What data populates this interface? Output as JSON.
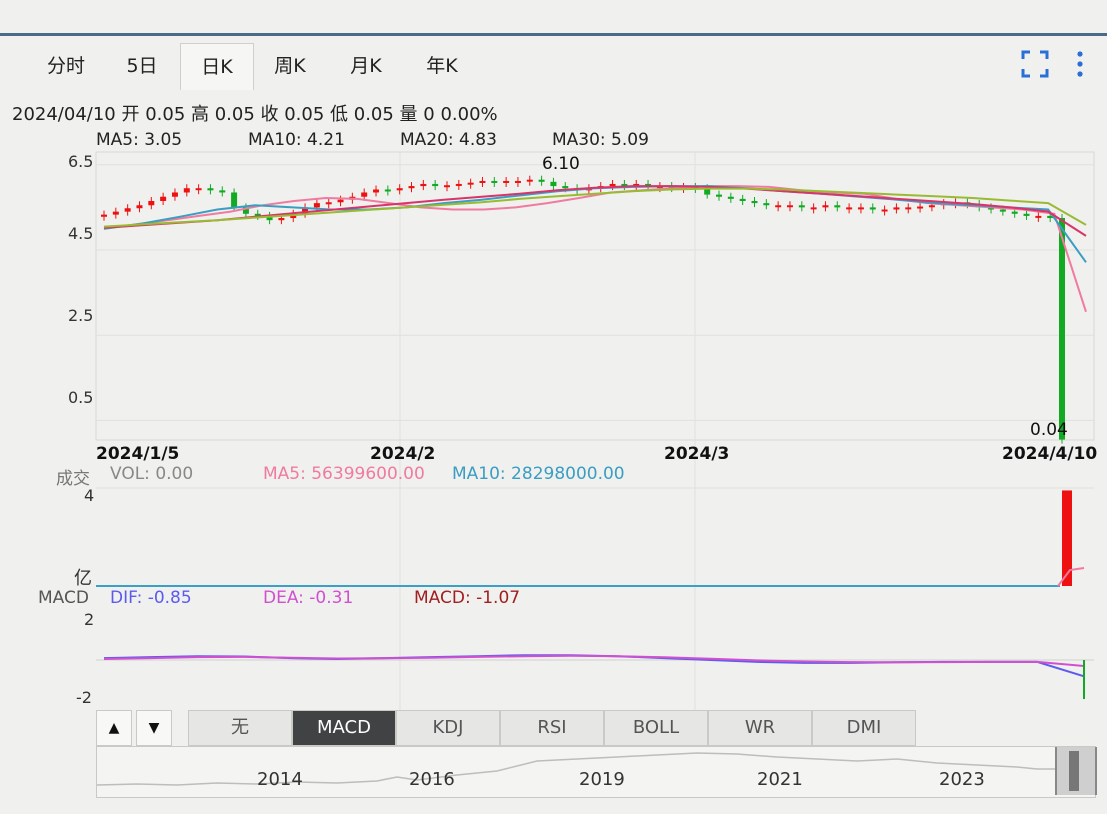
{
  "tabs": [
    {
      "label": "分时"
    },
    {
      "label": "5日"
    },
    {
      "label": "日K"
    },
    {
      "label": "周K"
    },
    {
      "label": "月K"
    },
    {
      "label": "年K"
    }
  ],
  "active_tab": "日K",
  "quote": {
    "text": "2024/04/10 开 0.05 高 0.05 收 0.05 低 0.05 量 0 0.00%"
  },
  "ma_labels": [
    {
      "text": "MA5: 3.05",
      "color": "#f07aa0"
    },
    {
      "text": "MA10: 4.21",
      "color": "#3a9ec2"
    },
    {
      "text": "MA20: 4.83",
      "color": "#d8346a"
    },
    {
      "text": "MA30: 5.09",
      "color": "#7a9a2a"
    }
  ],
  "volume_labels": {
    "title": "成交",
    "vol": "VOL: 0.00",
    "ma5": "MA5: 56399600.00",
    "ma10": "MA10: 28298000.00",
    "unit": "亿"
  },
  "macd_labels": {
    "title": "MACD",
    "dif": "DIF: -0.85",
    "dea": "DEA: -0.31",
    "macd": "MACD: -1.07"
  },
  "indicator_tabs": [
    "无",
    "MACD",
    "KDJ",
    "RSI",
    "BOLL",
    "WR",
    "DMI"
  ],
  "active_indicator": "MACD",
  "navigator_years": [
    "2014",
    "2016",
    "2019",
    "2021",
    "2023"
  ],
  "chart_data": [
    {
      "type": "candlestick",
      "x_labels": [
        "2024/1/5",
        "2024/2",
        "2024/3",
        "2024/4/10"
      ],
      "y_ticks": [
        "6.5",
        "4.5",
        "2.5",
        "0.5"
      ],
      "ylim": [
        0.04,
        6.5
      ],
      "annotations": {
        "high": "6.10",
        "low": "0.04"
      },
      "colors": {
        "up": "#ee1111",
        "down": "#11aa22",
        "ma5": "#f07aa0",
        "ma10": "#3a9ec2",
        "ma20": "#d8346a",
        "ma30": "#99bb33"
      },
      "closes": [
        5.33,
        5.4,
        5.48,
        5.55,
        5.65,
        5.75,
        5.85,
        5.95,
        5.95,
        5.9,
        5.85,
        5.5,
        5.35,
        5.3,
        5.2,
        5.25,
        5.35,
        5.5,
        5.6,
        5.62,
        5.68,
        5.75,
        5.85,
        5.92,
        5.9,
        5.95,
        6.0,
        6.05,
        6.0,
        6.02,
        6.05,
        6.08,
        6.12,
        6.1,
        6.12,
        6.12,
        6.15,
        6.1,
        6.0,
        5.95,
        5.9,
        5.95,
        6.0,
        6.05,
        6.02,
        6.05,
        6.0,
        6.0,
        5.98,
        5.98,
        5.95,
        5.8,
        5.75,
        5.7,
        5.65,
        5.6,
        5.55,
        5.55,
        5.55,
        5.5,
        5.5,
        5.55,
        5.5,
        5.5,
        5.5,
        5.45,
        5.45,
        5.5,
        5.5,
        5.52,
        5.55,
        5.6,
        5.62,
        5.58,
        5.5,
        5.45,
        5.4,
        5.35,
        5.3,
        5.3,
        5.25,
        0.05
      ],
      "ma": {
        "MA5": [
          5.0,
          5.1,
          5.2,
          5.3,
          5.4,
          5.55,
          5.65,
          5.72,
          5.7,
          5.6,
          5.5,
          5.45,
          5.45,
          5.5,
          5.6,
          5.72,
          5.85,
          5.9,
          5.95,
          6.0,
          6.0,
          5.98,
          5.9,
          5.85,
          5.82,
          5.7,
          5.6,
          5.55,
          5.5,
          5.45,
          5.35,
          3.05
        ],
        "MA10": [
          5.0,
          5.12,
          5.28,
          5.45,
          5.55,
          5.5,
          5.45,
          5.45,
          5.5,
          5.6,
          5.68,
          5.78,
          5.88,
          5.95,
          5.98,
          6.0,
          6.0,
          5.95,
          5.88,
          5.82,
          5.75,
          5.68,
          5.6,
          5.55,
          5.5,
          5.45,
          4.21
        ],
        "MA20": [
          5.02,
          5.08,
          5.14,
          5.2,
          5.28,
          5.36,
          5.44,
          5.52,
          5.6,
          5.68,
          5.75,
          5.82,
          5.9,
          5.96,
          6.0,
          6.0,
          5.98,
          5.94,
          5.88,
          5.82,
          5.76,
          5.7,
          5.64,
          5.58,
          5.5,
          5.4,
          4.83
        ],
        "MA30": [
          5.05,
          5.1,
          5.15,
          5.2,
          5.26,
          5.32,
          5.38,
          5.44,
          5.5,
          5.56,
          5.62,
          5.7,
          5.76,
          5.82,
          5.88,
          5.92,
          5.94,
          5.94,
          5.92,
          5.88,
          5.84,
          5.8,
          5.76,
          5.72,
          5.66,
          5.6,
          5.09
        ]
      }
    },
    {
      "type": "bar",
      "title": "成交",
      "y_ticks": [
        "4",
        "亿"
      ],
      "last_volume": 3.9,
      "unit": "亿"
    },
    {
      "type": "line",
      "title": "MACD",
      "y_ticks": [
        "2",
        "-2"
      ],
      "ylim": [
        -2.5,
        2.5
      ],
      "series": [
        {
          "name": "DIF",
          "color": "#5b5bf0",
          "values": [
            0.1,
            0.15,
            0.2,
            0.18,
            0.1,
            0.05,
            0.1,
            0.15,
            0.2,
            0.25,
            0.25,
            0.2,
            0.1,
            0.0,
            -0.1,
            -0.15,
            -0.15,
            -0.12,
            -0.1,
            -0.1,
            -0.1,
            -0.85
          ]
        },
        {
          "name": "DEA",
          "color": "#d050d0",
          "values": [
            0.05,
            0.1,
            0.15,
            0.16,
            0.12,
            0.08,
            0.09,
            0.12,
            0.16,
            0.2,
            0.22,
            0.2,
            0.14,
            0.06,
            -0.02,
            -0.08,
            -0.11,
            -0.12,
            -0.11,
            -0.1,
            -0.1,
            -0.31
          ]
        }
      ],
      "last_macd": -1.07
    }
  ]
}
